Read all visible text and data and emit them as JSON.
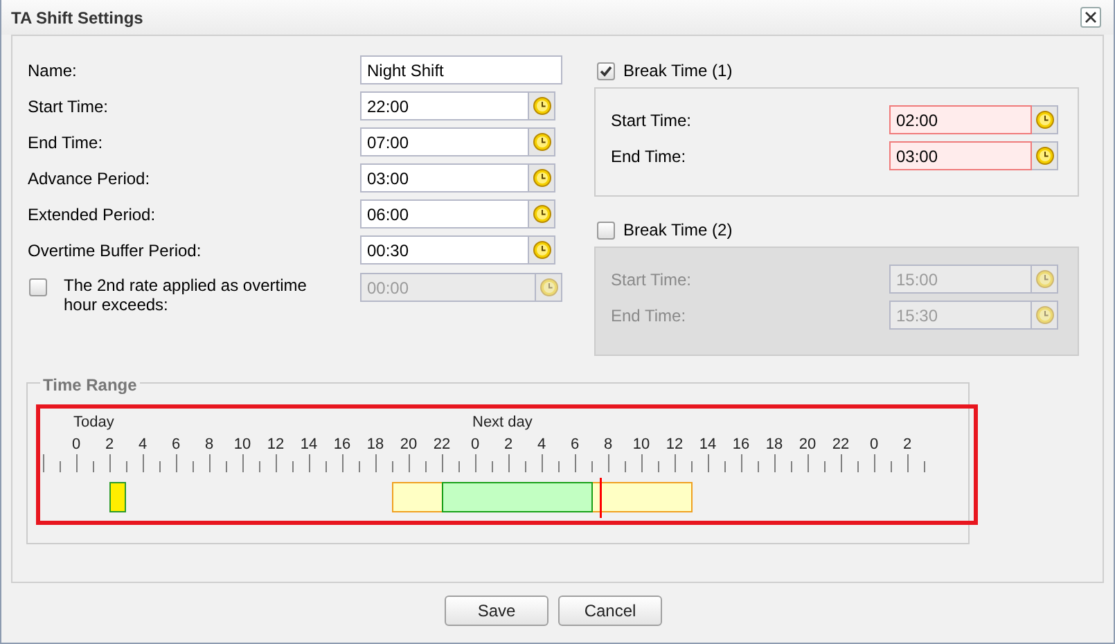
{
  "window": {
    "title": "TA Shift Settings"
  },
  "fields": [
    {
      "label": "Name:",
      "value": "Night Shift",
      "kind": "text"
    },
    {
      "label": "Start Time:",
      "value": "22:00",
      "kind": "time"
    },
    {
      "label": "End Time:",
      "value": "07:00",
      "kind": "time"
    },
    {
      "label": "Advance Period:",
      "value": "03:00",
      "kind": "time"
    },
    {
      "label": "Extended Period:",
      "value": "06:00",
      "kind": "time"
    },
    {
      "label": "Overtime Buffer Period:",
      "value": "00:30",
      "kind": "time"
    }
  ],
  "second_rate": {
    "label": "The 2nd rate applied as overtime hour exceeds:",
    "checked": false,
    "value": "00:00"
  },
  "breaks": [
    {
      "label": "Break Time (1)",
      "checked": true,
      "invalid": true,
      "start_label": "Start Time:",
      "start": "02:00",
      "end_label": "End Time:",
      "end": "03:00"
    },
    {
      "label": "Break Time (2)",
      "checked": false,
      "invalid": false,
      "start_label": "Start Time:",
      "start": "15:00",
      "end_label": "End Time:",
      "end": "15:30"
    }
  ],
  "time_range": {
    "title": "Time Range",
    "highlighted": true,
    "day_labels": [
      "Today",
      "Next day"
    ],
    "hour_labels": [
      "0",
      "2",
      "4",
      "6",
      "8",
      "10",
      "12",
      "14",
      "16",
      "18",
      "20",
      "22",
      "0",
      "2",
      "4",
      "6",
      "8",
      "10",
      "12",
      "14",
      "16",
      "18",
      "20",
      "22",
      "0",
      "2"
    ]
  },
  "buttons": [
    "Save",
    "Cancel"
  ]
}
